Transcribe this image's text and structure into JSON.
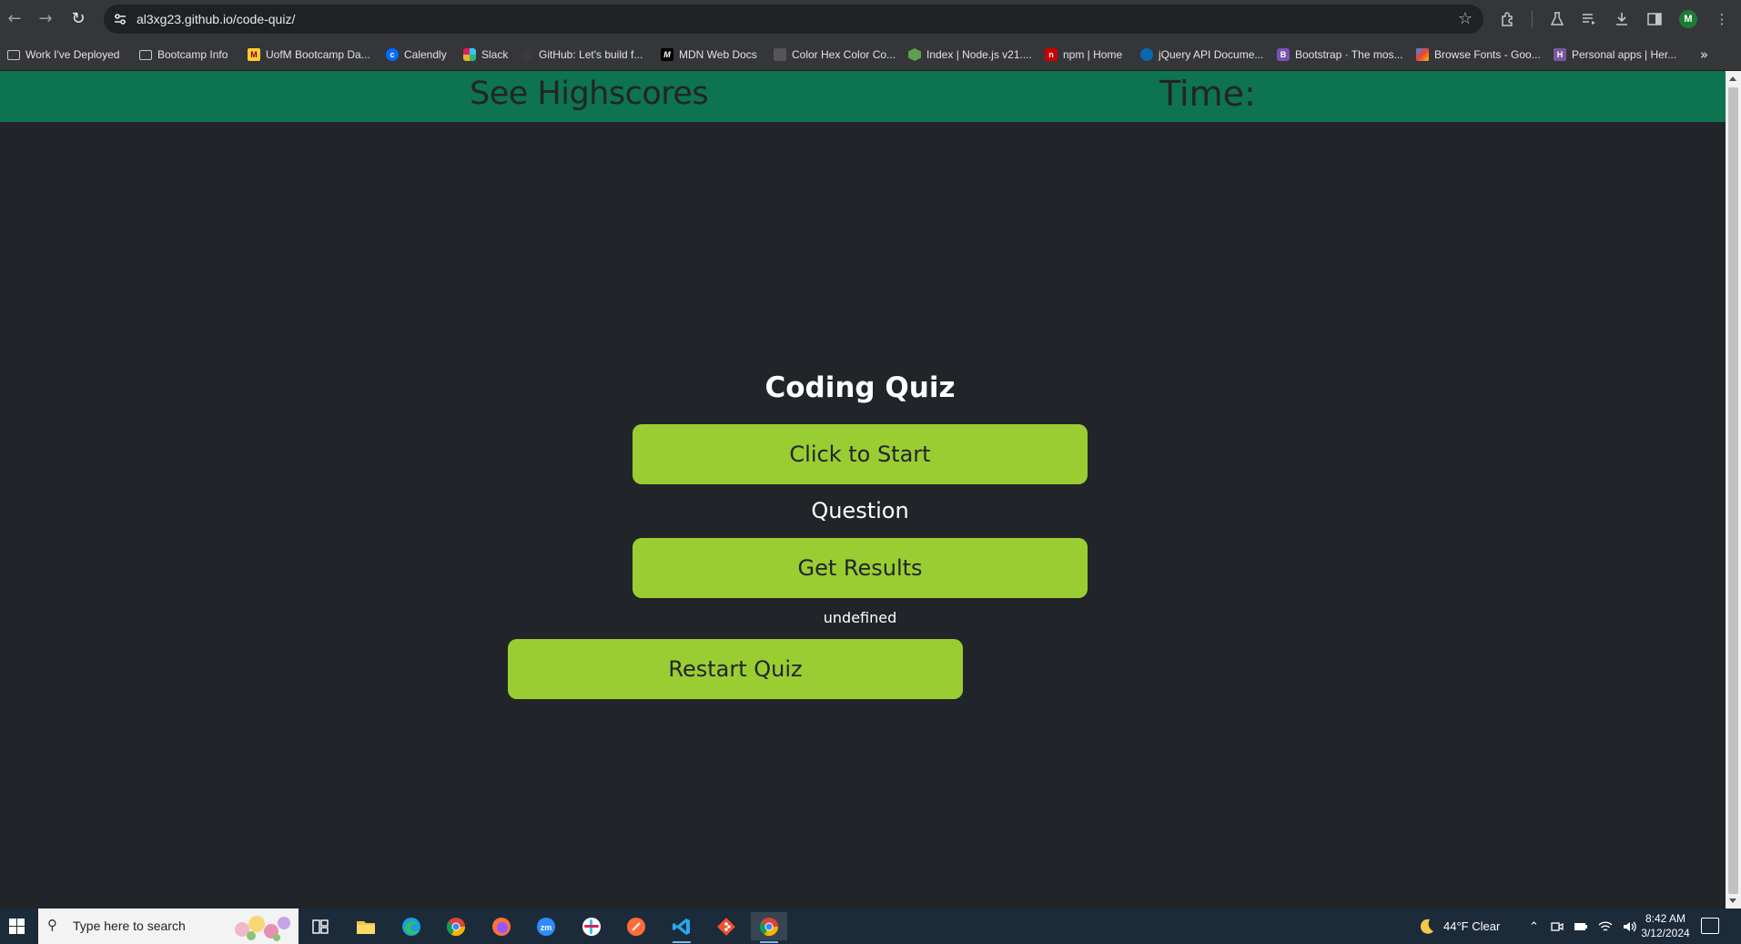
{
  "browser": {
    "url": "al3xg23.github.io/code-quiz/",
    "bookmarks": [
      {
        "label": "Work I've Deployed",
        "icon": "folder-icon",
        "color": "#c4c7c5"
      },
      {
        "label": "Bootcamp Info",
        "icon": "folder-icon",
        "color": "#c4c7c5"
      },
      {
        "label": "UofM Bootcamp Da...",
        "icon": "uofm-icon",
        "color": "#ffcc33"
      },
      {
        "label": "Calendly",
        "icon": "calendly-icon",
        "color": "#006bff"
      },
      {
        "label": "Slack",
        "icon": "slack-icon",
        "color": "#e01e5a"
      },
      {
        "label": "GitHub: Let's build f...",
        "icon": "github-icon",
        "color": "#3a3a3a"
      },
      {
        "label": "MDN Web Docs",
        "icon": "mdn-icon",
        "color": "#000000"
      },
      {
        "label": "Color Hex Color Co...",
        "icon": "colorhex-icon",
        "color": "#555555"
      },
      {
        "label": "Index | Node.js v21....",
        "icon": "nodejs-icon",
        "color": "#5fa04e"
      },
      {
        "label": "npm | Home",
        "icon": "npm-icon",
        "color": "#cb0000"
      },
      {
        "label": "jQuery API Docume...",
        "icon": "jquery-icon",
        "color": "#0769ad"
      },
      {
        "label": "Bootstrap · The mos...",
        "icon": "bootstrap-icon",
        "color": "#7952b3"
      },
      {
        "label": "Browse Fonts - Goo...",
        "icon": "google-fonts-icon",
        "color": "#ea4335"
      },
      {
        "label": "Personal apps | Her...",
        "icon": "heroku-icon",
        "color": "#79589f"
      }
    ],
    "profile_initial": "M"
  },
  "page": {
    "header": {
      "highscores_link": "See Highscores",
      "time_label": "Time:"
    },
    "title": "Coding Quiz",
    "start_button": "Click to Start",
    "question_text": "Question",
    "results_button": "Get Results",
    "results_text": "undefined",
    "restart_button": "Restart Quiz",
    "colors": {
      "header_bg": "#0e7350",
      "page_bg": "#212529",
      "button_bg": "#9acd32"
    }
  },
  "taskbar": {
    "search_placeholder": "Type here to search",
    "weather": "44°F  Clear",
    "time": "8:42 AM",
    "date": "3/12/2024",
    "apps": [
      "task-view-icon",
      "file-explorer-icon",
      "edge-icon",
      "chrome-icon",
      "firefox-icon",
      "zoom-icon",
      "slack-icon",
      "postman-icon",
      "vscode-icon",
      "git-icon",
      "chrome-profile-icon"
    ]
  }
}
